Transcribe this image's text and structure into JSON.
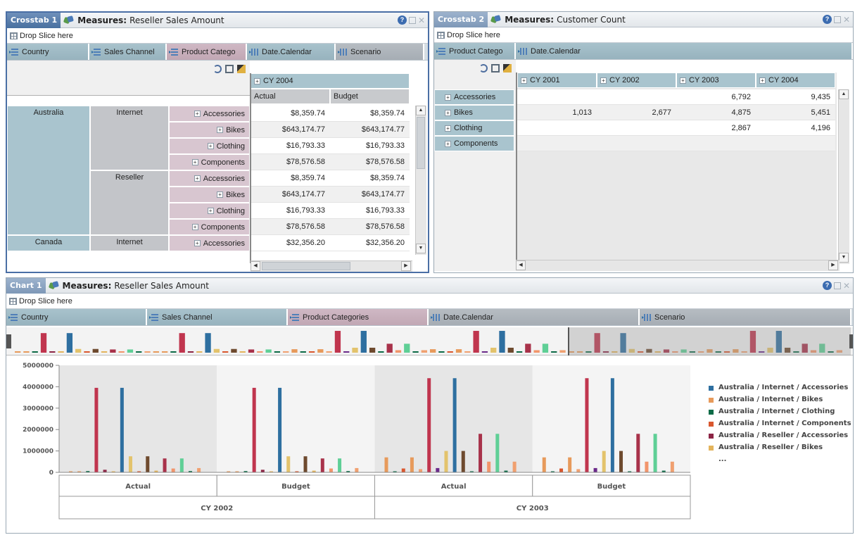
{
  "crosstab1": {
    "tab_name": "Crosstab 1",
    "measures_label": "Measures:",
    "measure": "Reseller Sales Amount",
    "drop_slice": "Drop Slice here",
    "dims": [
      {
        "label": "Country",
        "style": "blue"
      },
      {
        "label": "Sales Channel",
        "style": "blue"
      },
      {
        "label": "Product Catego",
        "style": "rose"
      },
      {
        "label": "Date.Calendar",
        "style": "blue"
      },
      {
        "label": "Scenario",
        "style": "gray"
      }
    ],
    "col_header": "CY 2004",
    "col_sub": [
      "Actual",
      "Budget"
    ],
    "countries": [
      "Australia",
      "Canada"
    ],
    "channels": [
      "Internet",
      "Reseller",
      "Internet"
    ],
    "categories": [
      "Accessories",
      "Bikes",
      "Clothing",
      "Components",
      "Accessories",
      "Bikes",
      "Clothing",
      "Components",
      "Accessories"
    ],
    "actual": [
      "$8,359.74",
      "$643,174.77",
      "$16,793.33",
      "$78,576.58",
      "$8,359.74",
      "$643,174.77",
      "$16,793.33",
      "$78,576.58",
      "$32,356.20"
    ],
    "budget": [
      "$8,359.74",
      "$643,174.77",
      "$16,793.33",
      "$78,576.58",
      "$8,359.74",
      "$643,174.77",
      "$16,793.33",
      "$78,576.58",
      "$32,356.20"
    ]
  },
  "crosstab2": {
    "tab_name": "Crosstab 2",
    "measures_label": "Measures:",
    "measure": "Customer Count",
    "drop_slice": "Drop Slice here",
    "dims": [
      {
        "label": "Product Catego",
        "style": "blue"
      },
      {
        "label": "Date.Calendar",
        "style": "blue"
      }
    ],
    "years": [
      "CY 2001",
      "CY 2002",
      "CY 2003",
      "CY 2004"
    ],
    "categories": [
      "Accessories",
      "Bikes",
      "Clothing",
      "Components"
    ],
    "rows": [
      [
        "",
        "",
        "6,792",
        "9,435"
      ],
      [
        "1,013",
        "2,677",
        "4,875",
        "5,451"
      ],
      [
        "",
        "",
        "2,867",
        "4,196"
      ],
      [
        "",
        "",
        "",
        ""
      ]
    ]
  },
  "chart1": {
    "tab_name": "Chart 1",
    "measures_label": "Measures:",
    "measure": "Reseller Sales Amount",
    "drop_slice": "Drop Slice here",
    "dims": [
      {
        "label": "Country",
        "style": "blue"
      },
      {
        "label": "Sales Channel",
        "style": "blue"
      },
      {
        "label": "Product Categories",
        "style": "rose"
      },
      {
        "label": "Date.Calendar",
        "style": "gray"
      },
      {
        "label": "Scenario",
        "style": "gray"
      }
    ],
    "legend_more": "...",
    "icons": [
      "help-icon",
      "maximize-icon",
      "close-icon",
      "grid-icon",
      "pivot-icon",
      "filter-icon",
      "select-icon"
    ]
  },
  "chart_data": {
    "type": "bar",
    "ylim": [
      0,
      5000000
    ],
    "yticks": [
      "0",
      "1000000",
      "2000000",
      "3000000",
      "4000000",
      "5000000"
    ],
    "groups": [
      "Actual",
      "Budget",
      "Actual",
      "Budget"
    ],
    "years": [
      "CY 2002",
      "CY 2003"
    ],
    "series": [
      {
        "name": "Australia / Internet / Accessories",
        "color": "#2e6fa0"
      },
      {
        "name": "Australia / Internet / Bikes",
        "color": "#e79a5b"
      },
      {
        "name": "Australia / Internet / Clothing",
        "color": "#0d6b47"
      },
      {
        "name": "Australia / Internet / Components",
        "color": "#d9572e"
      },
      {
        "name": "Australia / Reseller / Accessories",
        "color": "#8c2545"
      },
      {
        "name": "Australia / Reseller / Bikes",
        "color": "#e3b45c"
      }
    ],
    "bars_2002": [
      {
        "v": 0,
        "c": "#e79a5b"
      },
      {
        "v": 0,
        "c": "#e79a5b"
      },
      {
        "v": 60000,
        "c": "#0d6b47"
      },
      {
        "v": 3950000,
        "c": "#c0354e"
      },
      {
        "v": 120000,
        "c": "#8c2545"
      },
      {
        "v": 0,
        "c": "#e3b45c"
      },
      {
        "v": 3950000,
        "c": "#2e6fa0"
      },
      {
        "v": 750000,
        "c": "#e3c36c"
      },
      {
        "v": 50000,
        "c": "#d9572e"
      },
      {
        "v": 750000,
        "c": "#6e4a2e"
      },
      {
        "v": 80000,
        "c": "#e3b45c"
      },
      {
        "v": 650000,
        "c": "#a8324a"
      },
      {
        "v": 180000,
        "c": "#f2956b"
      },
      {
        "v": 650000,
        "c": "#5fcf96"
      },
      {
        "v": 60000,
        "c": "#0d6b47"
      },
      {
        "v": 200000,
        "c": "#f0a070"
      }
    ],
    "bars_2003": [
      {
        "v": 700000,
        "c": "#e79a5b"
      },
      {
        "v": 50000,
        "c": "#0d6b47"
      },
      {
        "v": 180000,
        "c": "#d9572e"
      },
      {
        "v": 700000,
        "c": "#e79a5b"
      },
      {
        "v": 150000,
        "c": "#f0a070"
      },
      {
        "v": 4400000,
        "c": "#c0354e"
      },
      {
        "v": 200000,
        "c": "#6b2a8a"
      },
      {
        "v": 1000000,
        "c": "#e3c36c"
      },
      {
        "v": 4400000,
        "c": "#2e6fa0"
      },
      {
        "v": 1000000,
        "c": "#6e4a2e"
      },
      {
        "v": 50000,
        "c": "#0d6b47"
      },
      {
        "v": 1800000,
        "c": "#a8324a"
      },
      {
        "v": 500000,
        "c": "#f2956b"
      },
      {
        "v": 1800000,
        "c": "#5fcf96"
      },
      {
        "v": 80000,
        "c": "#0d6b47"
      },
      {
        "v": 500000,
        "c": "#f0a070"
      }
    ]
  }
}
